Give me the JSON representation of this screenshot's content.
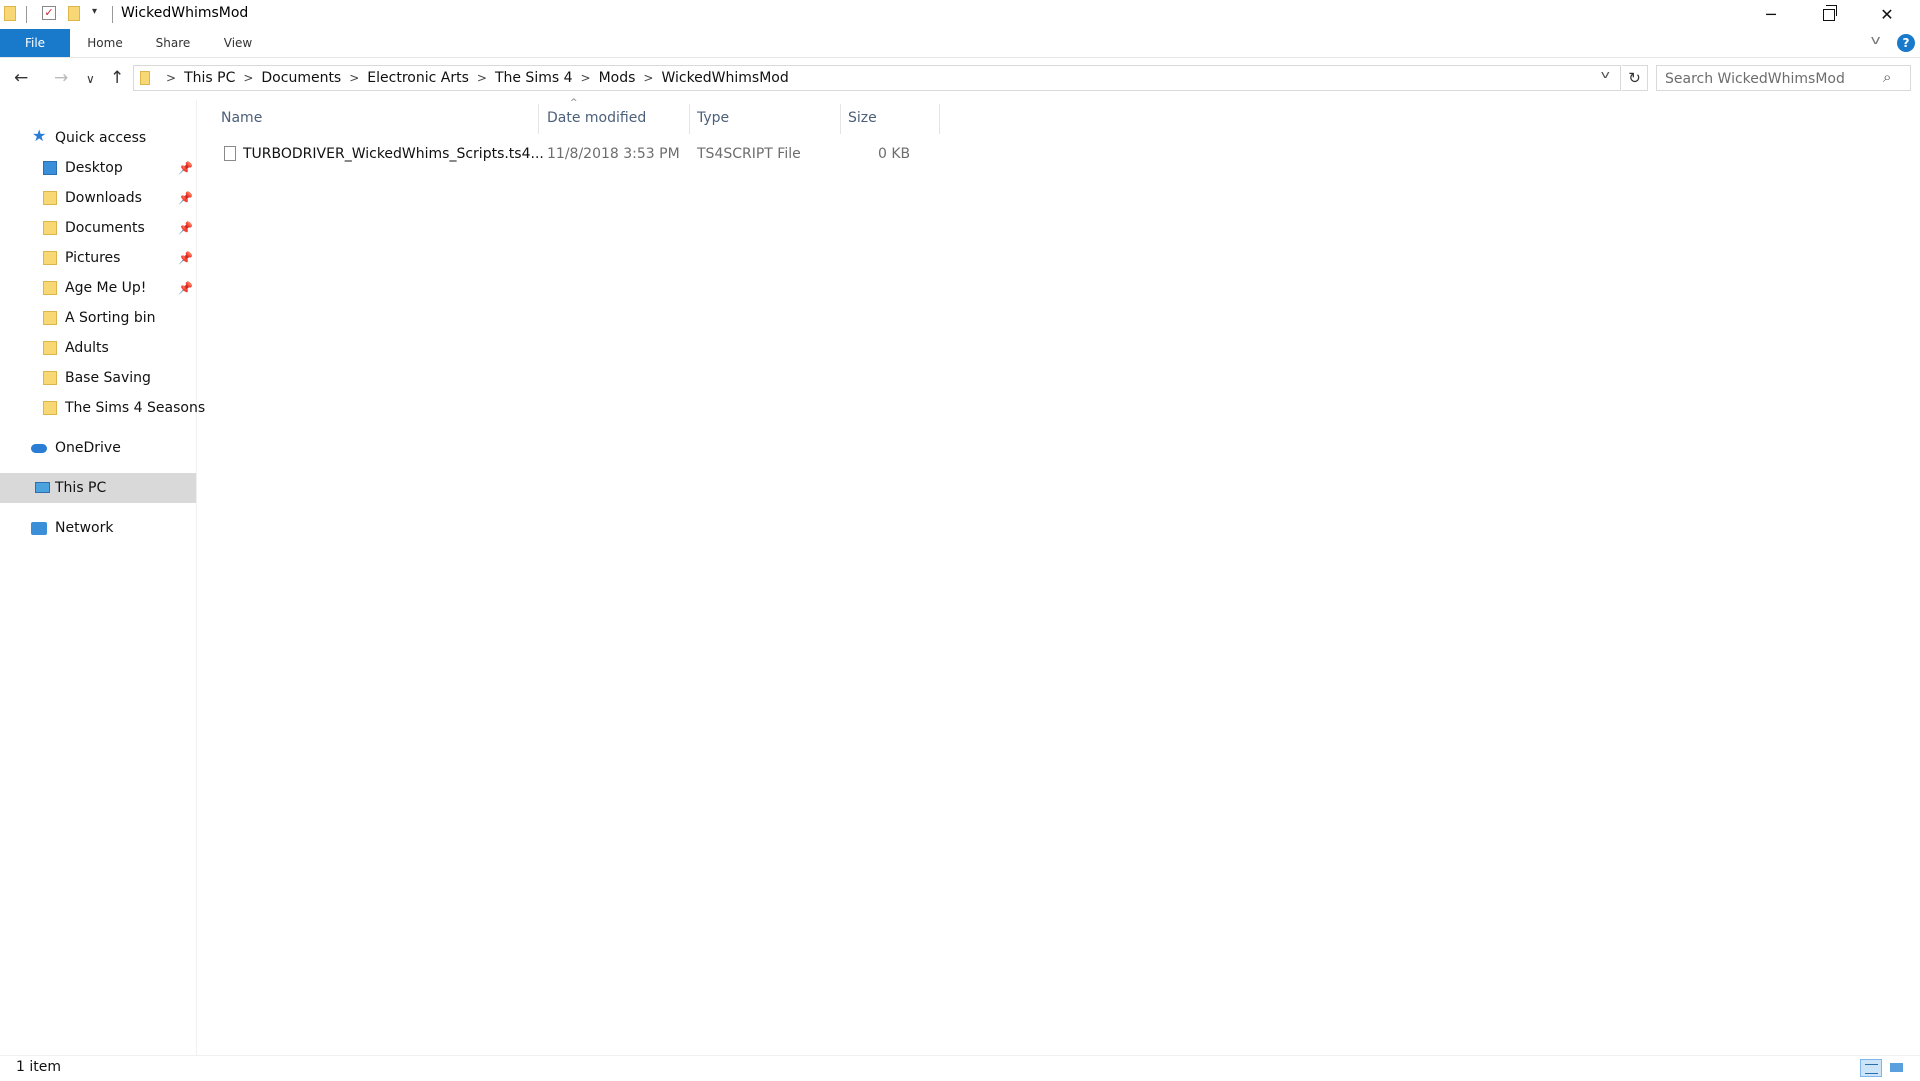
{
  "window": {
    "title": "WickedWhimsMod",
    "quick_access_toolbar": [
      "folder-icon",
      "properties-icon",
      "new-folder-icon",
      "customize-toolbar-arrow"
    ],
    "controls": [
      "minimize",
      "maximize",
      "close"
    ]
  },
  "ribbon": {
    "tabs": [
      "File",
      "Home",
      "Share",
      "View"
    ],
    "active_tab": "File",
    "accent_color": "#1979ca"
  },
  "address_bar": {
    "breadcrumbs": [
      "This PC",
      "Documents",
      "Electronic Arts",
      "The Sims 4",
      "Mods",
      "WickedWhimsMod"
    ]
  },
  "search": {
    "placeholder": "Search WickedWhimsMod"
  },
  "nav_pane": {
    "quick_access_label": "Quick access",
    "quick_access": [
      {
        "label": "Desktop",
        "pinned": true,
        "icon": "desktop-folder-icon"
      },
      {
        "label": "Downloads",
        "pinned": true,
        "icon": "downloads-folder-icon"
      },
      {
        "label": "Documents",
        "pinned": true,
        "icon": "documents-folder-icon"
      },
      {
        "label": "Pictures",
        "pinned": true,
        "icon": "pictures-folder-icon"
      },
      {
        "label": "Age Me Up!",
        "pinned": true,
        "icon": "folder-icon"
      },
      {
        "label": "A Sorting bin",
        "pinned": false,
        "icon": "folder-icon"
      },
      {
        "label": "Adults",
        "pinned": false,
        "icon": "folder-icon"
      },
      {
        "label": "Base Saving",
        "pinned": false,
        "icon": "folder-icon"
      },
      {
        "label": "The Sims 4 Seasons",
        "pinned": false,
        "icon": "folder-icon"
      }
    ],
    "onedrive_label": "OneDrive",
    "thispc_label": "This PC",
    "network_label": "Network",
    "selected": "This PC"
  },
  "file_list": {
    "columns": {
      "name": "Name",
      "date": "Date modified",
      "type": "Type",
      "size": "Size"
    },
    "sorted_by": "Name",
    "rows": [
      {
        "name": "TURBODRIVER_WickedWhims_Scripts.ts4...",
        "date": "11/8/2018 3:53 PM",
        "type": "TS4SCRIPT File",
        "size": "0 KB"
      }
    ]
  },
  "status_bar": {
    "item_count": "1 item",
    "view_modes": [
      "details",
      "large-icons"
    ],
    "active_view": "details"
  }
}
